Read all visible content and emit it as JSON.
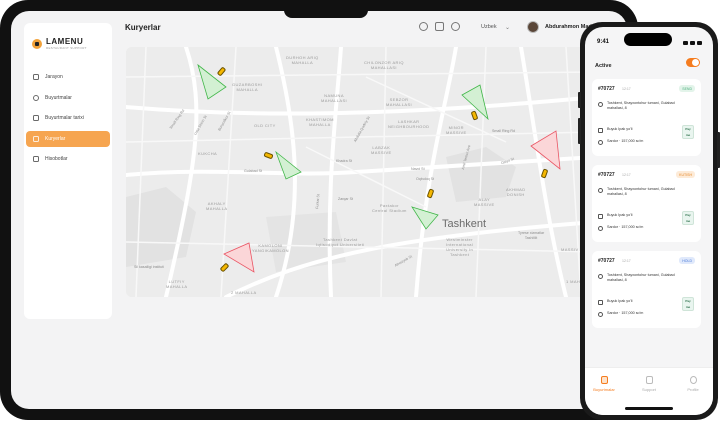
{
  "app": {
    "logo_text": "LAMENU",
    "logo_sub": "RESTAURANT SUPPORT"
  },
  "sidebar": {
    "items": [
      {
        "label": "Jarayon",
        "icon": "activity-icon"
      },
      {
        "label": "Buyurtmalar",
        "icon": "orders-icon"
      },
      {
        "label": "Buyurtmalar tarixi",
        "icon": "history-icon"
      },
      {
        "label": "Kuryerlar",
        "icon": "couriers-icon",
        "active": true
      },
      {
        "label": "Hisobotlar",
        "icon": "reports-icon"
      }
    ]
  },
  "header": {
    "title": "Kuryerlar",
    "language": "Uzbek",
    "user_name": "Abdurahmon Madminov"
  },
  "map": {
    "city": "Tashkent",
    "labels": {
      "durhoh_ariq": "DURHOH ARIQ\nMAHALLA",
      "chilonzor_ariq": "CHILONZOR ARIQ\nMAHALLASI",
      "guzarboshi": "GUZARBOSHI\nMAHALLA",
      "namuna": "NAMUNA\nMAHALLASI",
      "sebzor": "SEBZOR\nMAHALLASI",
      "old_city": "OLD CITY",
      "khastimom": "KHASTIMOM\nMAHALLA",
      "lashkar": "LASHKAR\nNEIGHBOURHOOD",
      "minor": "MINOR\nMASSIVE",
      "kukcha": "KUKCHA",
      "labzak": "LABZAK\nMASSIVE",
      "akhmad": "AKHMAD\nDONISH",
      "akhaly": "AKHALY\nMAHALLA",
      "alay": "ALAY\nMASSIVE",
      "paxtakor": "Paxtakor\nCentral Stadium",
      "tashkent_state": "Tashkent Davlat\nIqtisodiyot Universiteti",
      "westminster": "Westminster\nInternational\nUniversity in\nTashkent",
      "kamoloni": "KAMOLONI\nYANGIKAMOLON",
      "lutfiy": "LUTFIY\nMAHALLA",
      "mahalla2": "2 MAHALLA",
      "mahalla1": "1 MAHALLA",
      "massive": "MASSIV",
      "toshkent_ishsizlik": "Tyrese xizmatlar\nTashMit",
      "st_kasalligi": "Sil kasalligi instituti"
    },
    "streets": [
      "Small Ring Rd",
      "Sayalvi St",
      "Usta Shirin St",
      "Bunyodkor St",
      "Gulabad St",
      "Khadra St",
      "Zarqar St",
      "Furkat St",
      "Navoi St",
      "Oqbuloq St",
      "Small Ring Rd",
      "Amir Temur Ave",
      "Osiyo St",
      "Abdulla Qodiriy St",
      "Afrosiyob St"
    ],
    "icons": [
      "taxi-car-icon",
      "courier-direction-green",
      "courier-direction-red"
    ]
  },
  "phone": {
    "time": "9:41",
    "active_label": "Active",
    "orders": [
      {
        "id": "#70727",
        "time": "12:17",
        "badge": "SEND",
        "badge_color": "#4caf7d",
        "badge_bg": "#e3f4ea",
        "address": "Toshkent, Shayxontohur tumani, Gulabad mahallasi, 8",
        "method": "Buyuk Ipak yo'li",
        "sum": "Sardor · 157,000 so'm"
      },
      {
        "id": "#70727",
        "time": "12:17",
        "badge": "KUTISH",
        "badge_color": "#e68a2e",
        "badge_bg": "#fdebd8",
        "address": "Toshkent, Shayxontohur tumani, Gulabad mahallasi, 8",
        "method": "Buyuk Ipak yo'li",
        "sum": "Sardor · 157,000 so'm"
      },
      {
        "id": "#70727",
        "time": "12:17",
        "badge": "HOLD",
        "badge_color": "#4a7bd8",
        "badge_bg": "#e0e9fb",
        "address": "Toshkent, Shayxontohur tumani, Gulabad mahallasi, 8",
        "method": "Buyuk Ipak yo'li",
        "sum": "Sardor · 157,000 so'm"
      }
    ],
    "pay_label": "Pay\nme",
    "tabs": [
      {
        "label": "Buyurtmalar",
        "active": true
      },
      {
        "label": "Support"
      },
      {
        "label": "Profile"
      }
    ]
  },
  "colors": {
    "accent": "#f6a550",
    "toggle": "#f57c1f"
  }
}
